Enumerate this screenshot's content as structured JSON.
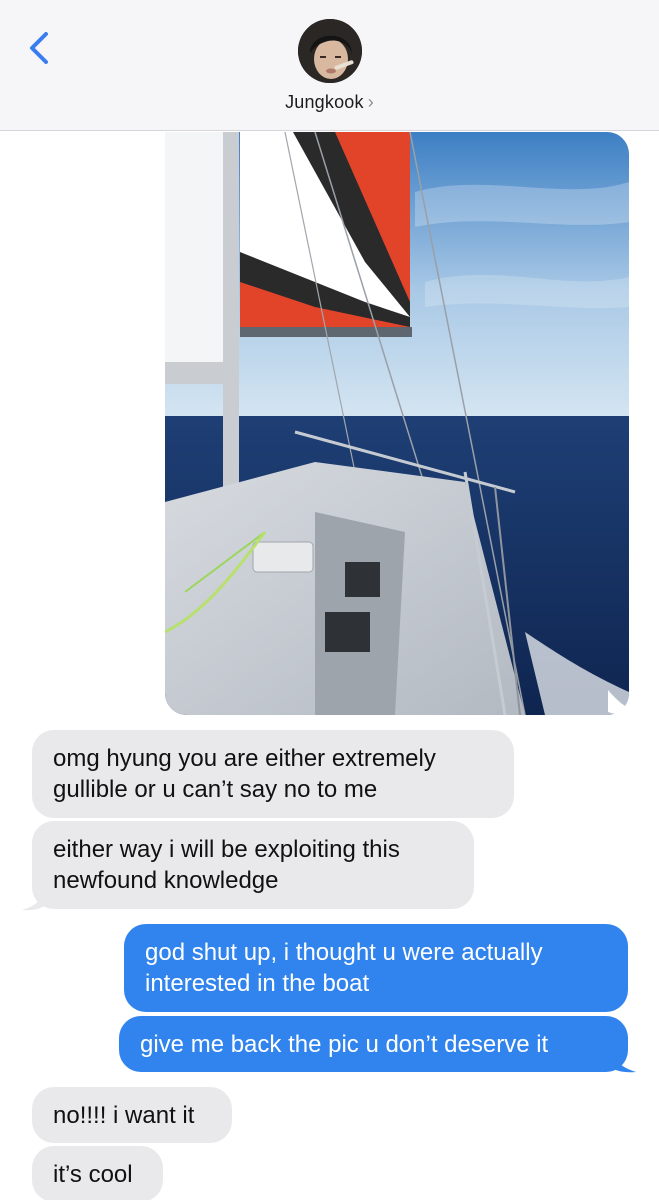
{
  "header": {
    "contact_name": "Jungkook",
    "chevron": "›",
    "back_icon": "chevron-left-icon",
    "accent_color": "#3a7df1"
  },
  "photo": {
    "description_icon": "sailboat-photo"
  },
  "messages": [
    {
      "direction": "incoming",
      "lines": [
        "omg hyung you are either extremely",
        "gullible or u can’t say no to me"
      ]
    },
    {
      "direction": "incoming",
      "lines": [
        "either way i will be exploiting this",
        "newfound knowledge"
      ]
    },
    {
      "direction": "outgoing",
      "lines": [
        "god shut up, i thought u were actually",
        "interested in the boat"
      ]
    },
    {
      "direction": "outgoing",
      "lines": [
        "give me back the pic u don’t deserve it"
      ]
    },
    {
      "direction": "incoming",
      "lines": [
        "no!!!! i want it"
      ]
    },
    {
      "direction": "incoming",
      "lines": [
        "it’s cool"
      ]
    }
  ],
  "colors": {
    "incoming_bubble": "#e9e9eb",
    "outgoing_bubble": "#3184ee",
    "header_bg": "#f6f6f8"
  }
}
